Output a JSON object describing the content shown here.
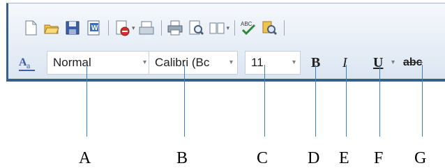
{
  "toolbar": {
    "icons": [
      "new-document-icon",
      "open-folder-icon",
      "save-icon",
      "word-document-icon",
      "permission-icon",
      "email-icon",
      "print-icon",
      "print-preview-icon",
      "read-mode-icon",
      "spelling-check-icon",
      "research-icon"
    ]
  },
  "formatting": {
    "style_value": "Normal",
    "font_value": "Calibri (Bc",
    "size_value": "11",
    "bold_label": "B",
    "italic_label": "I",
    "underline_label": "U",
    "strike_label": "abc",
    "arrow_glyph": "▾"
  },
  "labels": {
    "a": "A",
    "b": "B",
    "c": "C",
    "d": "D",
    "e": "E",
    "f": "F",
    "g": "G"
  },
  "colors": {
    "frame_border": "#35608e",
    "callout_line": "#3b7fc4"
  }
}
